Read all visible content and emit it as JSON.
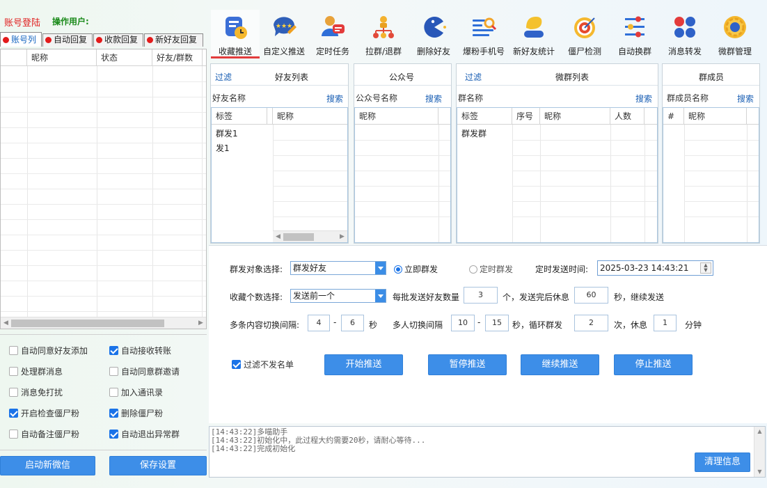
{
  "header": {
    "login": "账号登陆",
    "operator": "操作用户:"
  },
  "left_tabs": [
    "账号列",
    "自动回复",
    "收款回复",
    "新好友回复"
  ],
  "account_table": {
    "columns": [
      "",
      "昵称",
      "状态",
      "好友/群数"
    ]
  },
  "options": [
    {
      "label": "自动同意好友添加",
      "checked": false
    },
    {
      "label": "自动接收转账",
      "checked": true
    },
    {
      "label": "处理群消息",
      "checked": false
    },
    {
      "label": "自动同意群邀请",
      "checked": false
    },
    {
      "label": "消息免打扰",
      "checked": false
    },
    {
      "label": "加入通讯录",
      "checked": false
    },
    {
      "label": "开启检查僵尸粉",
      "checked": true
    },
    {
      "label": "删除僵尸粉",
      "checked": true
    },
    {
      "label": "自动备注僵尸粉",
      "checked": false
    },
    {
      "label": "自动退出异常群",
      "checked": true
    }
  ],
  "left_buttons": {
    "start_wechat": "启动新微信",
    "save": "保存设置"
  },
  "toolbar": [
    {
      "label": "收藏推送",
      "icon": "favorite-push-icon",
      "active": true
    },
    {
      "label": "自定义推送",
      "icon": "custom-push-icon",
      "active": false
    },
    {
      "label": "定时任务",
      "icon": "scheduled-task-icon",
      "active": false
    },
    {
      "label": "拉群/退群",
      "icon": "group-pull-icon",
      "active": false
    },
    {
      "label": "删除好友",
      "icon": "delete-friend-icon",
      "active": false
    },
    {
      "label": "爆粉手机号",
      "icon": "phone-search-icon",
      "active": false
    },
    {
      "label": "新好友统计",
      "icon": "new-friend-stats-icon",
      "active": false
    },
    {
      "label": "僵尸检测",
      "icon": "zombie-detect-icon",
      "active": false
    },
    {
      "label": "自动换群",
      "icon": "auto-switch-group-icon",
      "active": false
    },
    {
      "label": "消息转发",
      "icon": "message-forward-icon",
      "active": false
    },
    {
      "label": "微群管理",
      "icon": "group-manage-icon",
      "active": false
    }
  ],
  "friends_panel": {
    "filter": "过滤",
    "title": "好友列表",
    "name_label": "好友名称",
    "search": "搜索",
    "columns": [
      "标签",
      "",
      "昵称"
    ],
    "rows": [
      "群发1",
      "发1"
    ]
  },
  "official_panel": {
    "title": "公众号",
    "name_label": "公众号名称",
    "search": "搜索",
    "columns": [
      "昵称"
    ]
  },
  "groups_panel": {
    "filter": "过滤",
    "title": "微群列表",
    "name_label": "群名称",
    "search": "搜索",
    "columns": [
      "标签",
      "序号",
      "昵称",
      "人数"
    ],
    "rows": [
      "群发群"
    ]
  },
  "members_panel": {
    "title": "群成员",
    "name_label": "群成员名称",
    "search": "搜索",
    "columns": [
      "#",
      "昵称"
    ]
  },
  "form": {
    "target_label": "群发对象选择:",
    "target_value": "群发好友",
    "send_now": "立即群发",
    "send_scheduled": "定时群发",
    "send_mode": "now",
    "time_label": "定时发送时间:",
    "time_value": "2025-03-23 14:43:21",
    "fav_count_label": "收藏个数选择:",
    "fav_count_value": "发送前一个",
    "batch_label": "每批发送好友数量",
    "batch_value": "3",
    "batch_unit": "个，发送完后休息",
    "rest_value": "60",
    "rest_unit": "秒，继续发送",
    "switch_label": "多条内容切换间隔:",
    "switch_min": "4",
    "dash": "-",
    "switch_max": "6",
    "sec": "秒",
    "multi_label": "多人切换间隔",
    "multi_min": "10",
    "multi_max": "15",
    "loop_label": "秒，循环群发",
    "loop_value": "2",
    "loop_unit": "次，休息",
    "rest_min_value": "1",
    "minute": "分钟",
    "filter_label": "过滤不发名单",
    "filter_checked": true,
    "buttons": {
      "start": "开始推送",
      "pause": "暂停推送",
      "resume": "继续推送",
      "stop": "停止推送"
    }
  },
  "log": {
    "lines": [
      "[14:43:22]多喵助手",
      "[14:43:22]初始化中，此过程大约需要20秒，请耐心等待...",
      "[14:43:22]完成初始化"
    ],
    "clear": "清理信息"
  }
}
